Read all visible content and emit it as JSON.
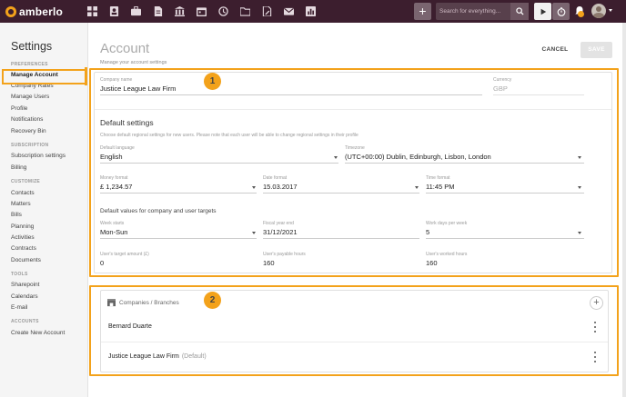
{
  "app": {
    "logo_text": "amberlo",
    "nav_icons": [
      "grid-icon",
      "contacts-icon",
      "briefcase-icon",
      "document-icon",
      "bank-icon",
      "calendar-icon",
      "history-icon",
      "folder-icon",
      "file-edit-icon",
      "mail-icon",
      "reports-icon"
    ],
    "search_placeholder": "Search for everything...",
    "add_label": "+",
    "brand_color": "#3c1e2e",
    "accent_color": "#f3a21b"
  },
  "sidebar": {
    "title": "Settings",
    "sections": [
      {
        "label": "PREFERENCES",
        "items": [
          "Manage Account",
          "Company Rates",
          "Manage Users",
          "Profile",
          "Notifications",
          "Recovery Bin"
        ]
      },
      {
        "label": "SUBSCRIPTION",
        "items": [
          "Subscription settings",
          "Billing"
        ]
      },
      {
        "label": "CUSTOMIZE",
        "items": [
          "Contacts",
          "Matters",
          "Bills",
          "Planning",
          "Activities",
          "Contracts",
          "Documents"
        ]
      },
      {
        "label": "TOOLS",
        "items": [
          "Sharepoint",
          "Calendars",
          "E-mail"
        ]
      },
      {
        "label": "ACCOUNTS",
        "items": [
          "Create New Account"
        ]
      }
    ],
    "active_item": "Manage Account"
  },
  "header": {
    "title": "Account",
    "subtitle": "Manage your account settings",
    "cancel_label": "CANCEL",
    "save_label": "SAVE"
  },
  "annotations": {
    "badge1": "1",
    "badge2": "2"
  },
  "account": {
    "company_name_label": "Company name",
    "company_name_value": "Justice League Law Firm",
    "currency_label": "Currency",
    "currency_value": "GBP"
  },
  "defaults": {
    "heading": "Default settings",
    "description": "Choose default regional settings for new users. Please note that each user will be able to change regional settings in their profile",
    "language_label": "Default language",
    "language_value": "English",
    "timezone_label": "Timezone",
    "timezone_value": "(UTC+00:00) Dublin, Edinburgh, Lisbon, London",
    "money_label": "Money format",
    "money_value": "£ 1,234.57",
    "date_label": "Date format",
    "date_value": "15.03.2017",
    "time_label": "Time format",
    "time_value": "11:45 PM"
  },
  "targets": {
    "heading": "Default values for company and user targets",
    "week_starts_label": "Week starts",
    "week_starts_value": "Mon-Sun",
    "fiscal_label": "Fiscal year end",
    "fiscal_value": "31/12/2021",
    "workdays_label": "Work days per week",
    "workdays_value": "5",
    "target_amount_label": "User's target amount (£)",
    "target_amount_value": "0",
    "payable_label": "User's payable hours",
    "payable_value": "160",
    "worked_label": "User's worked hours",
    "worked_value": "160"
  },
  "companies": {
    "heading": "Companies / Branches",
    "add_label": "+",
    "rows": [
      {
        "name": "Bernard Duarte",
        "tag": ""
      },
      {
        "name": "Justice League Law Firm",
        "tag": "(Default)"
      }
    ]
  }
}
